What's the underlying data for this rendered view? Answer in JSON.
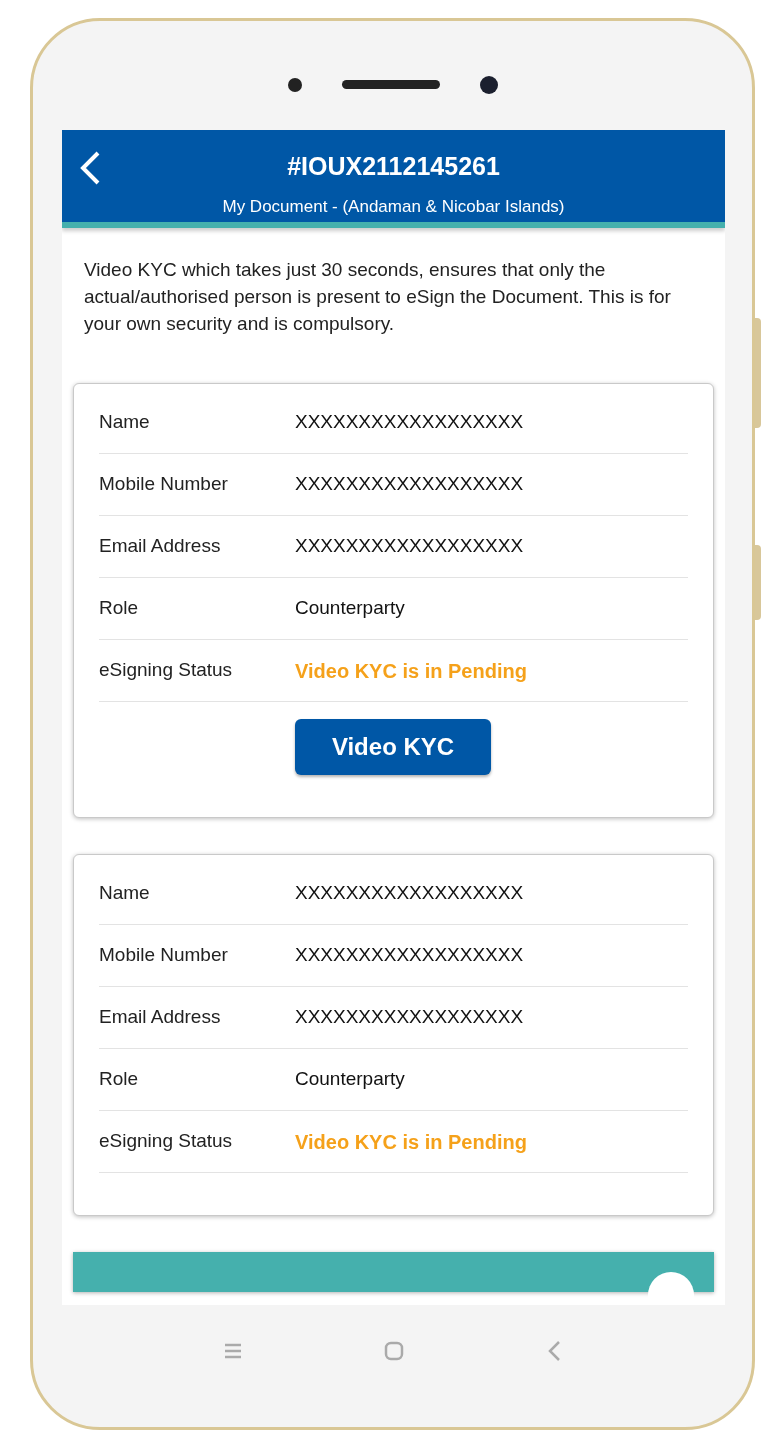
{
  "header": {
    "title": "#IOUX2112145261",
    "subtitle": "My Document - (Andaman & Nicobar Islands)"
  },
  "intro": "Video KYC which takes just 30 seconds, ensures that only the actual/authorised person is present to eSign the Document. This is for your own security and is compulsory.",
  "cards": [
    {
      "fields": [
        {
          "label": "Name",
          "value": "XXXXXXXXXXXXXXXXXX",
          "kind": "text"
        },
        {
          "label": "Mobile Number",
          "value": "XXXXXXXXXXXXXXXXXX",
          "kind": "text"
        },
        {
          "label": "Email Address",
          "value": "XXXXXXXXXXXXXXXXXX",
          "kind": "text"
        },
        {
          "label": "Role",
          "value": "Counterparty",
          "kind": "text"
        },
        {
          "label": "eSigning Status",
          "value": "Video KYC is in Pending",
          "kind": "status"
        }
      ],
      "button": "Video KYC"
    },
    {
      "fields": [
        {
          "label": "Name",
          "value": "XXXXXXXXXXXXXXXXXX",
          "kind": "text"
        },
        {
          "label": "Mobile Number",
          "value": "XXXXXXXXXXXXXXXXXX",
          "kind": "text"
        },
        {
          "label": "Email Address",
          "value": "XXXXXXXXXXXXXXXXXX",
          "kind": "text"
        },
        {
          "label": "Role",
          "value": "Counterparty",
          "kind": "text"
        },
        {
          "label": "eSigning Status",
          "value": "Video KYC is in Pending",
          "kind": "status"
        }
      ]
    }
  ]
}
